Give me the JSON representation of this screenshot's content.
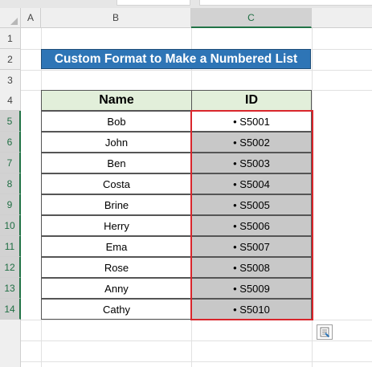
{
  "columns": [
    "A",
    "B",
    "C"
  ],
  "rows": [
    "1",
    "2",
    "3",
    "4",
    "5",
    "6",
    "7",
    "8",
    "9",
    "10",
    "11",
    "12",
    "13",
    "14"
  ],
  "title": "Custom Format to Make a Numbered List",
  "table": {
    "headers": [
      "Name",
      "ID"
    ],
    "rows": [
      {
        "name": "Bob",
        "id": "• S5001"
      },
      {
        "name": "John",
        "id": "• S5002"
      },
      {
        "name": "Ben",
        "id": "• S5003"
      },
      {
        "name": "Costa",
        "id": "• S5004"
      },
      {
        "name": "Brine",
        "id": "• S5005"
      },
      {
        "name": "Herry",
        "id": "• S5006"
      },
      {
        "name": "Ema",
        "id": "• S5007"
      },
      {
        "name": "Rose",
        "id": "• S5008"
      },
      {
        "name": "Anny",
        "id": "• S5009"
      },
      {
        "name": "Cathy",
        "id": "• S5010"
      }
    ]
  },
  "quick_analysis_icon": "quick-analysis-icon",
  "colors": {
    "title_fill": "#2e75b6",
    "header_fill": "#e2efda",
    "selected_fill": "#c8c8c8",
    "selection_border": "#d9262c",
    "selected_header_accent": "#217346"
  }
}
